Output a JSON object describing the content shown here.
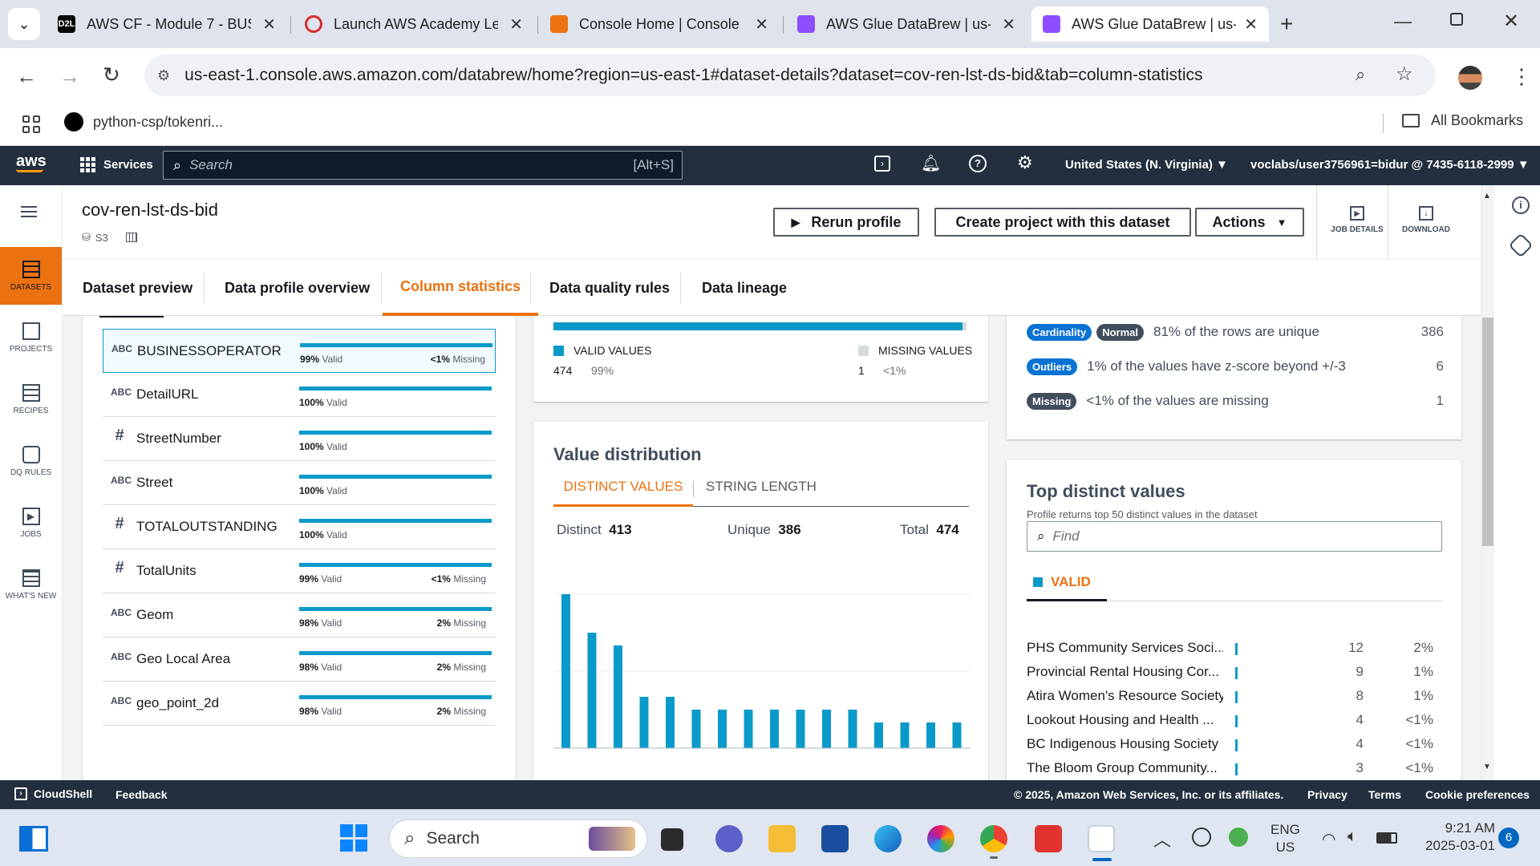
{
  "browser": {
    "tabs": [
      {
        "title": "AWS CF - Module 7 - BUS",
        "icon": "d2l-icon",
        "color": "#000000",
        "favtext": "D2L"
      },
      {
        "title": "Launch AWS Academy Le",
        "icon": "academy-icon",
        "color": "#d32f2f"
      },
      {
        "title": "Console Home | Console",
        "icon": "aws-console-icon",
        "color": "#ec7211"
      },
      {
        "title": "AWS Glue DataBrew | us-",
        "icon": "databrew-icon",
        "color": "#8c4fff"
      },
      {
        "title": "AWS Glue DataBrew | us-",
        "icon": "databrew-icon",
        "color": "#8c4fff"
      }
    ],
    "url": "us-east-1.console.aws.amazon.com/databrew/home?region=us-east-1#dataset-details?dataset=cov-ren-lst-ds-bid&tab=column-statistics",
    "bookmark": "python-csp/tokenri...",
    "all_bookmarks": "All Bookmarks"
  },
  "aws": {
    "logo": "aws",
    "services": "Services",
    "search_placeholder": "Search",
    "search_shortcut": "[Alt+S]",
    "region": "United States (N. Virginia)",
    "account": "voclabs/user3756961=bidur @ 7435-6118-2999"
  },
  "sidebar": [
    {
      "label": "DATASETS",
      "icon": "datasets-icon",
      "active": true
    },
    {
      "label": "PROJECTS",
      "icon": "projects-icon"
    },
    {
      "label": "RECIPES",
      "icon": "recipes-icon"
    },
    {
      "label": "DQ RULES",
      "icon": "dq-rules-icon"
    },
    {
      "label": "JOBS",
      "icon": "jobs-icon"
    },
    {
      "label": "WHAT'S NEW",
      "icon": "whats-new-icon"
    }
  ],
  "page": {
    "title": "cov-ren-lst-ds-bid",
    "source": "S3",
    "rerun": "Rerun profile",
    "create_project": "Create project with this dataset",
    "actions": "Actions",
    "job_details": "JOB DETAILS",
    "download": "DOWNLOAD"
  },
  "content_tabs": [
    "Dataset preview",
    "Data profile overview",
    "Column statistics",
    "Data quality rules",
    "Data lineage"
  ],
  "columns": [
    {
      "type": "ABC",
      "name": "BUSINESSOPERATOR",
      "valid": "99%",
      "missing": "<1%",
      "selected": true
    },
    {
      "type": "ABC",
      "name": "DetailURL",
      "valid": "100%",
      "missing": ""
    },
    {
      "type": "#",
      "name": "StreetNumber",
      "valid": "100%",
      "missing": ""
    },
    {
      "type": "ABC",
      "name": "Street",
      "valid": "100%",
      "missing": ""
    },
    {
      "type": "#",
      "name": "TOTALOUTSTANDING",
      "valid": "100%",
      "missing": ""
    },
    {
      "type": "#",
      "name": "TotalUnits",
      "valid": "99%",
      "missing": "<1%"
    },
    {
      "type": "ABC",
      "name": "Geom",
      "valid": "98%",
      "missing": "2%"
    },
    {
      "type": "ABC",
      "name": "Geo Local Area",
      "valid": "98%",
      "missing": "2%"
    },
    {
      "type": "ABC",
      "name": "geo_point_2d",
      "valid": "98%",
      "missing": "2%"
    }
  ],
  "valid_missing": {
    "valid_label": "VALID VALUES",
    "valid_count": "474",
    "valid_pct": "99%",
    "missing_label": "MISSING VALUES",
    "missing_count": "1",
    "missing_pct": "<1%",
    "valid_fraction": 0.99
  },
  "value_distribution": {
    "title": "Value distribution",
    "tab_distinct": "DISTINCT VALUES",
    "tab_length": "STRING LENGTH",
    "distinct_label": "Distinct",
    "distinct": "413",
    "unique_label": "Unique",
    "unique": "386",
    "total_label": "Total",
    "total": "474"
  },
  "chart_data": {
    "type": "bar",
    "values": [
      12,
      9,
      8,
      4,
      4,
      3,
      3,
      3,
      3,
      3,
      3,
      3,
      2,
      2,
      2,
      2
    ],
    "ylim": [
      0,
      12
    ],
    "grid": true
  },
  "metrics": [
    {
      "badge": "Cardinality",
      "badge2": "Normal",
      "text": "81% of the rows are unique",
      "count": "386"
    },
    {
      "badge": "Outliers",
      "text": "1% of the values have z-score beyond +/-3",
      "count": "6"
    },
    {
      "badge": "Missing",
      "text": "<1% of the values are missing",
      "count": "1"
    }
  ],
  "top_distinct": {
    "title": "Top distinct values",
    "subtitle": "Profile returns top 50 distinct values in the dataset",
    "find_placeholder": "Find",
    "valid_tab": "VALID",
    "rows": [
      {
        "label": "PHS Community Services Soci...",
        "count": "12",
        "pct": "2%"
      },
      {
        "label": "Provincial Rental Housing Cor...",
        "count": "9",
        "pct": "1%"
      },
      {
        "label": "Atira Women's Resource Society",
        "count": "8",
        "pct": "1%"
      },
      {
        "label": "Lookout Housing and Health ...",
        "count": "4",
        "pct": "<1%"
      },
      {
        "label": "BC Indigenous Housing Society",
        "count": "4",
        "pct": "<1%"
      },
      {
        "label": "The Bloom Group Community...",
        "count": "3",
        "pct": "<1%"
      }
    ]
  },
  "footer": {
    "cloudshell": "CloudShell",
    "feedback": "Feedback",
    "copyright": "© 2025, Amazon Web Services, Inc. or its affiliates.",
    "privacy": "Privacy",
    "terms": "Terms",
    "cookies": "Cookie preferences"
  },
  "taskbar": {
    "search": "Search",
    "lang1": "ENG",
    "lang2": "US",
    "time": "9:21 AM",
    "date": "2025-03-01",
    "notifications": "6"
  },
  "colors": {
    "accent": "#ec7211",
    "bar": "#0a9ac9",
    "header": "#232f3e"
  }
}
